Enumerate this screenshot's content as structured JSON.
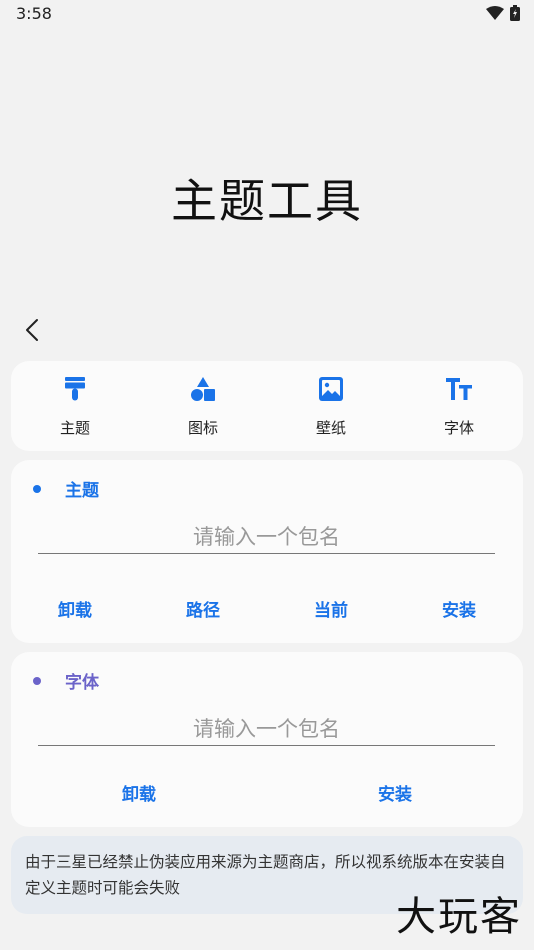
{
  "status": {
    "time": "3:58"
  },
  "app": {
    "title": "主题工具"
  },
  "tabs": [
    {
      "label": "主题",
      "icon": "paint-brush-icon"
    },
    {
      "label": "图标",
      "icon": "shapes-icon"
    },
    {
      "label": "壁纸",
      "icon": "image-icon"
    },
    {
      "label": "字体",
      "icon": "font-size-icon"
    }
  ],
  "theme_section": {
    "title": "主题",
    "placeholder": "请输入一个包名",
    "buttons": {
      "uninstall": "卸载",
      "path": "路径",
      "current": "当前",
      "install": "安装"
    }
  },
  "font_section": {
    "title": "字体",
    "placeholder": "请输入一个包名",
    "buttons": {
      "uninstall": "卸载",
      "install": "安装"
    }
  },
  "notice": {
    "text": "由于三星已经禁止伪装应用来源为主题商店，所以视系统版本在安装自定义主题时可能会失败"
  },
  "watermark": {
    "text": "大玩客"
  },
  "colors": {
    "accent": "#1a73e8",
    "font_accent": "#6b63c9",
    "theme_dot": "#1a73e8",
    "font_dot": "#6b63c9"
  }
}
